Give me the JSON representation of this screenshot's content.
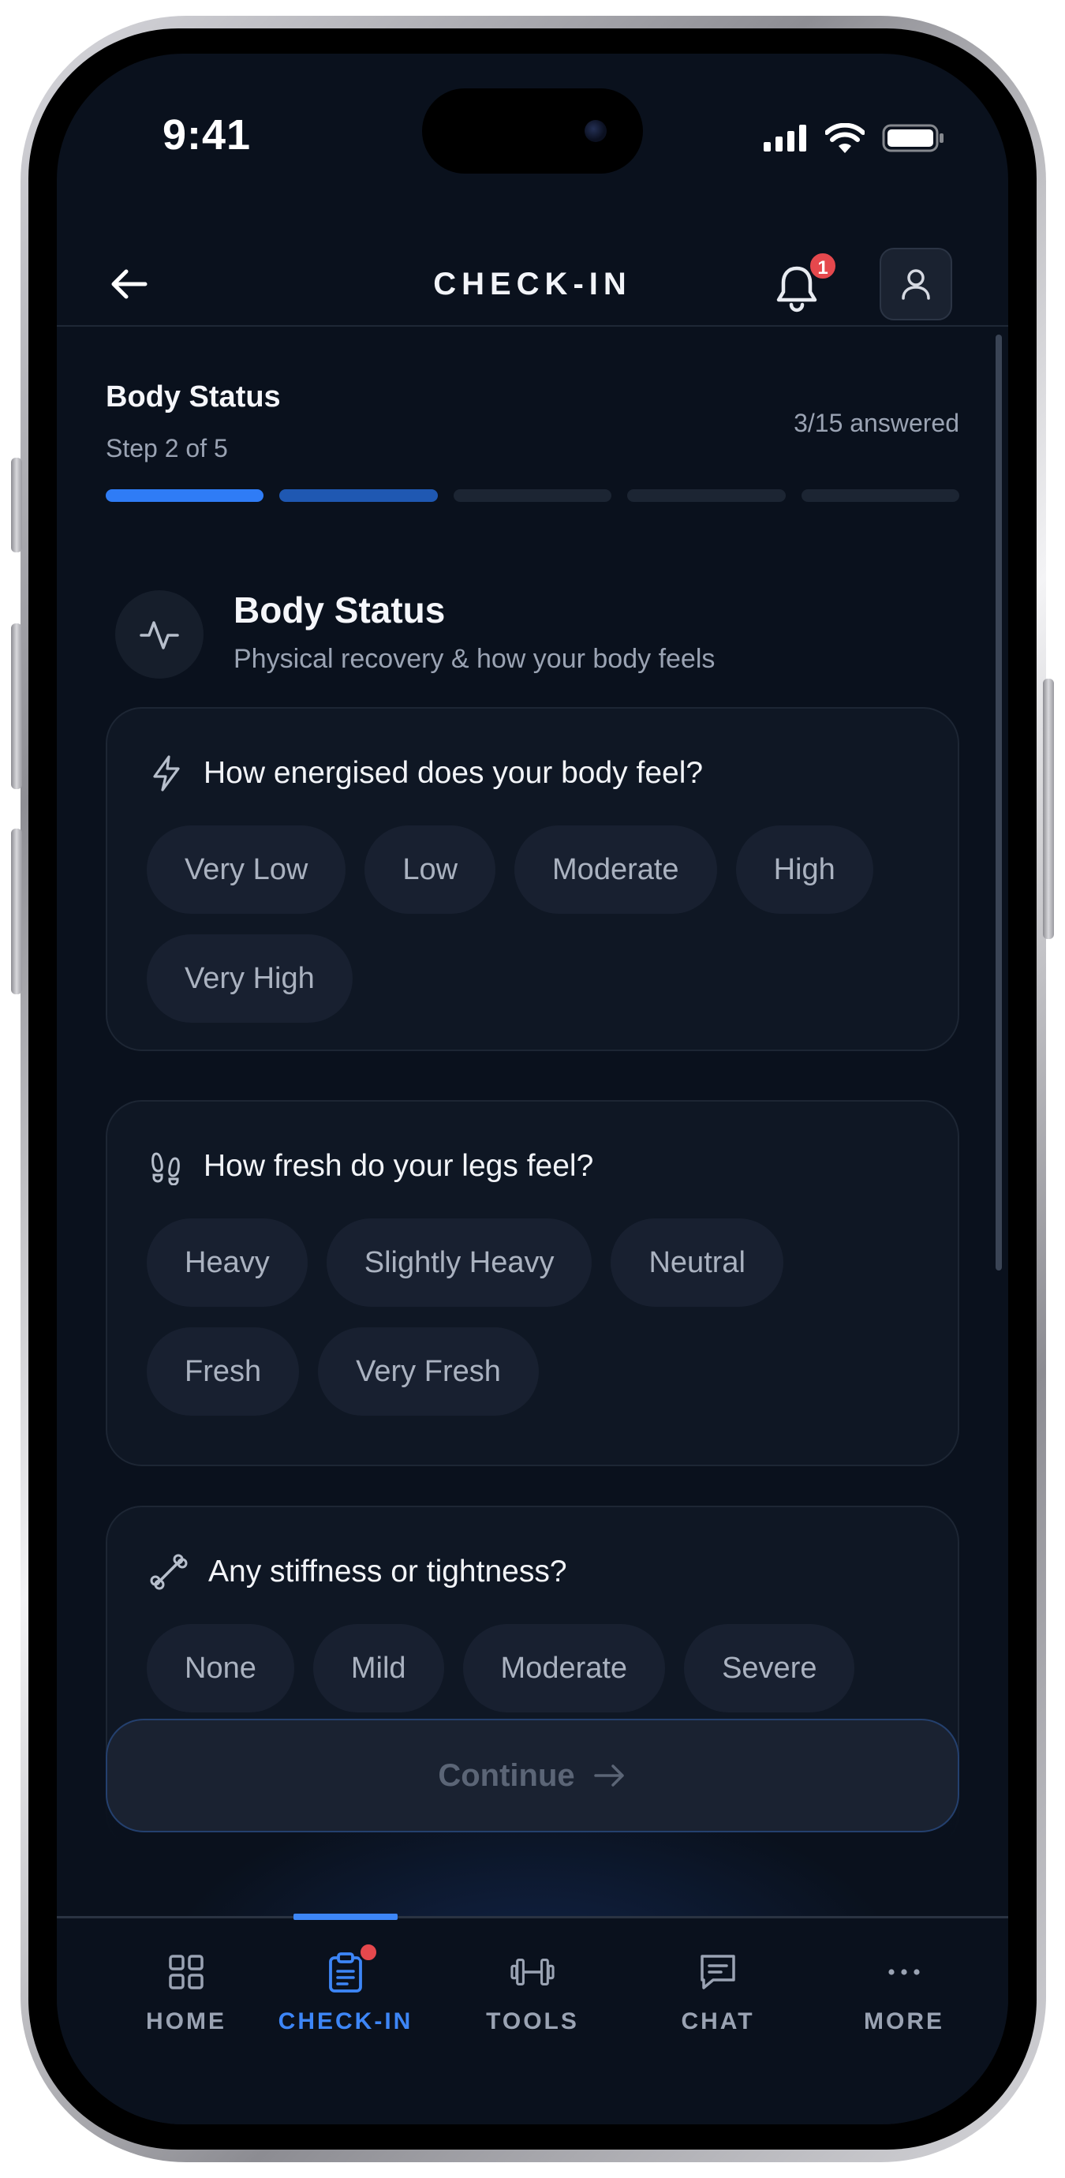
{
  "status_bar": {
    "time": "9:41"
  },
  "header": {
    "title": "CHECK-IN",
    "notification_count": "1"
  },
  "progress": {
    "title": "Body Status",
    "step": "Step 2 of 5",
    "answered": "3/15 answered",
    "segments": [
      "complete",
      "current",
      "pending",
      "pending",
      "pending"
    ]
  },
  "section": {
    "title": "Body Status",
    "subtitle": "Physical recovery & how your body feels",
    "icon": "activity-icon"
  },
  "questions": [
    {
      "icon": "lightning-icon",
      "text": "How energised does your body feel?",
      "options": [
        "Very Low",
        "Low",
        "Moderate",
        "High",
        "Very High"
      ]
    },
    {
      "icon": "footprints-icon",
      "text": "How fresh do your legs feel?",
      "options": [
        "Heavy",
        "Slightly Heavy",
        "Neutral",
        "Fresh",
        "Very Fresh"
      ]
    },
    {
      "icon": "bone-icon",
      "text": "Any stiffness or tightness?",
      "options": [
        "None",
        "Mild",
        "Moderate",
        "Severe"
      ]
    }
  ],
  "continue_label": "Continue",
  "tabs": [
    {
      "label": "HOME",
      "icon": "grid-icon"
    },
    {
      "label": "CHECK-IN",
      "icon": "clipboard-icon",
      "active": true
    },
    {
      "label": "TOOLS",
      "icon": "dumbbell-icon"
    },
    {
      "label": "CHAT",
      "icon": "chat-icon"
    },
    {
      "label": "MORE",
      "icon": "more-icon"
    }
  ],
  "colors": {
    "background": "#0a111d",
    "accent": "#2f7cf6",
    "badge": "#e5484d"
  }
}
